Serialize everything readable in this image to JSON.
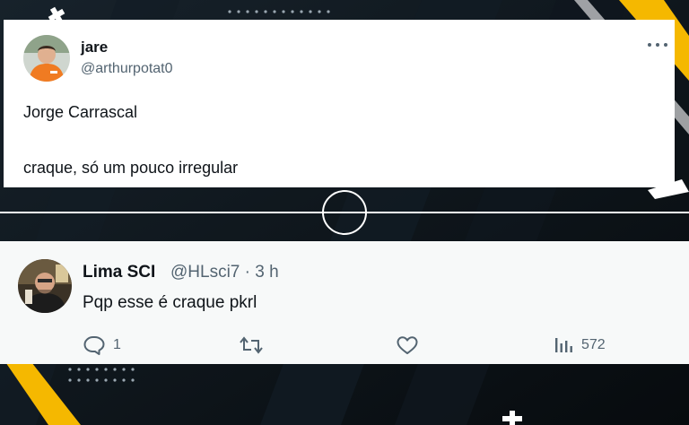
{
  "main_tweet": {
    "author_name": "jare",
    "author_handle": "@arthurpotat0",
    "text_line1": "Jorge Carrascal",
    "text_line2": "craque, só um pouco irregular",
    "icons": {
      "more": "more-horizontal-icon",
      "avatar": "avatar-photo"
    }
  },
  "reply_tweet": {
    "author_name": "Lima SCI",
    "author_handle": "@HLsci7",
    "separator": "·",
    "time": "3 h",
    "text": "Pqp esse é craque pkrl",
    "actions": {
      "reply_count": "1",
      "retweet_count": "",
      "like_count": "",
      "views_count": "572"
    },
    "icons": {
      "reply": "reply-bubble-icon",
      "retweet": "retweet-icon",
      "like": "heart-icon",
      "views": "views-bar-chart-icon"
    }
  },
  "colors": {
    "background": "#0b1116",
    "accent_yellow": "#f5b800",
    "text_primary": "#0f1419",
    "text_secondary": "#536471"
  }
}
